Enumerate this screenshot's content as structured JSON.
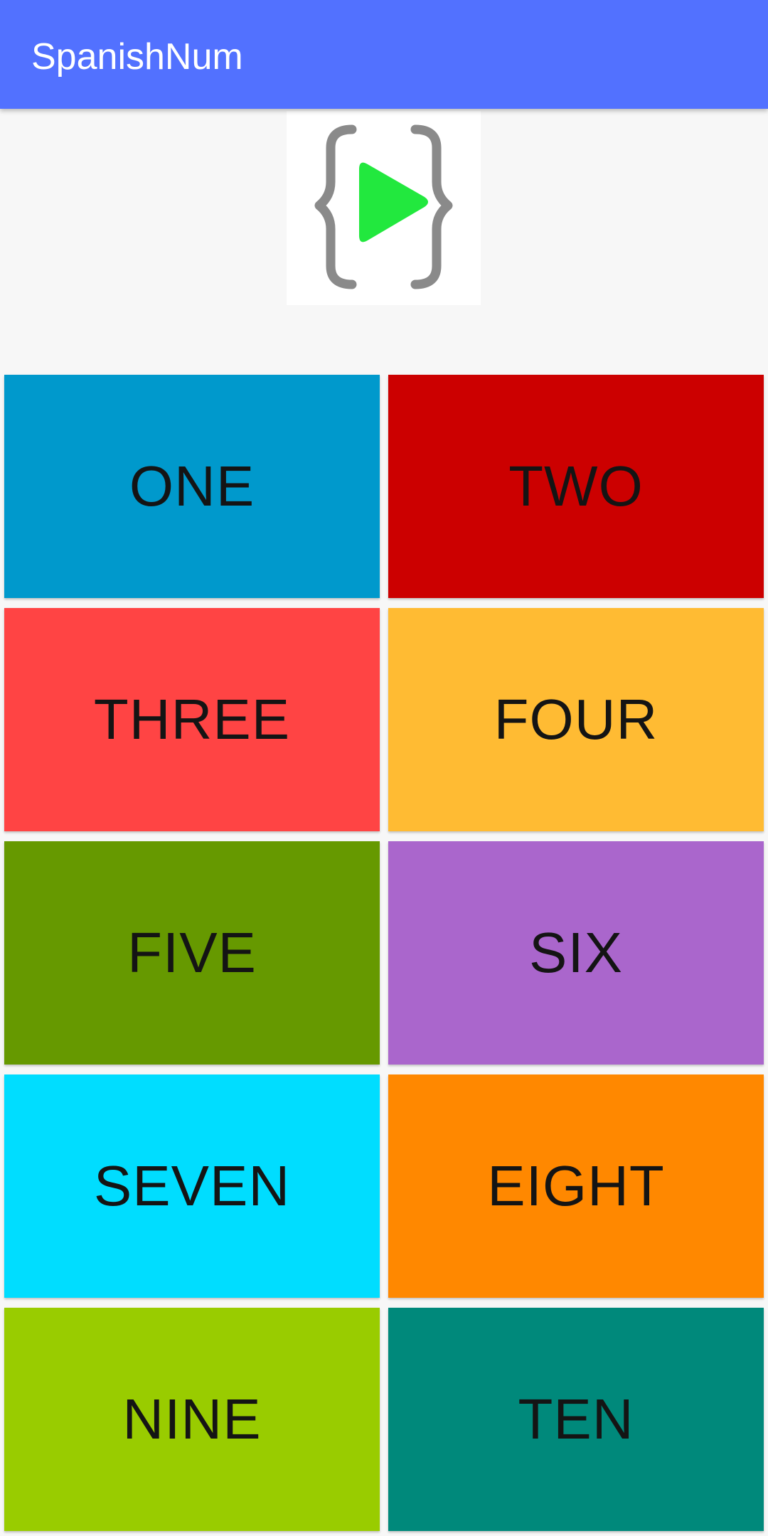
{
  "app": {
    "title": "SpanishNum",
    "bar_color": "#5271ff"
  },
  "logo": {
    "icon": "play-in-braces-icon",
    "brace_color": "#8a8a8a",
    "play_color": "#22e83e"
  },
  "numbers": [
    {
      "label": "ONE",
      "color": "#0099cc"
    },
    {
      "label": "TWO",
      "color": "#cc0000"
    },
    {
      "label": "THREE",
      "color": "#ff4444"
    },
    {
      "label": "FOUR",
      "color": "#ffbb33"
    },
    {
      "label": "FIVE",
      "color": "#669900"
    },
    {
      "label": "SIX",
      "color": "#aa66cc"
    },
    {
      "label": "SEVEN",
      "color": "#00ddff"
    },
    {
      "label": "EIGHT",
      "color": "#ff8800"
    },
    {
      "label": "NINE",
      "color": "#99cc00"
    },
    {
      "label": "TEN",
      "color": "#00897b"
    }
  ]
}
